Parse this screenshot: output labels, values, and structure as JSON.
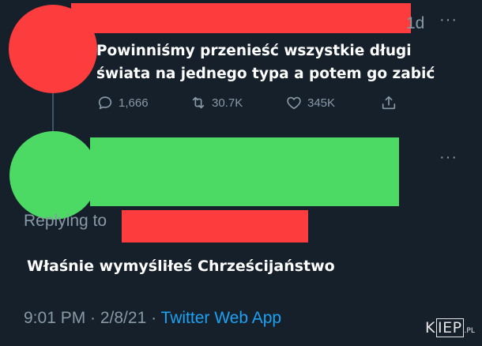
{
  "tweet": {
    "time_ago": "1d",
    "more": "···",
    "text_lines": [
      "Powinniśmy przenieść wszystkie długi",
      "świata na jednego typa a potem go zabić"
    ],
    "stats": {
      "replies": "1,666",
      "retweets": "30.7K",
      "likes": "345K"
    }
  },
  "reply": {
    "more": "···",
    "replying_to": "Replying to",
    "text": "Właśnie wymyśliłeś Chrześcijaństwo",
    "timestamp": "9:01 PM · 2/8/21 · ",
    "source": "Twitter Web App"
  },
  "watermark": {
    "k": "K",
    "boxed": "IEP",
    "suffix": ".PL"
  },
  "colors": {
    "background": "#15202b",
    "muted": "#8899a6",
    "link": "#1da1f2",
    "redaction_red": "#fd3d3d",
    "redaction_green": "#4cd964"
  },
  "icons": [
    "reply-icon",
    "retweet-icon",
    "like-icon",
    "share-icon",
    "more-icon"
  ]
}
